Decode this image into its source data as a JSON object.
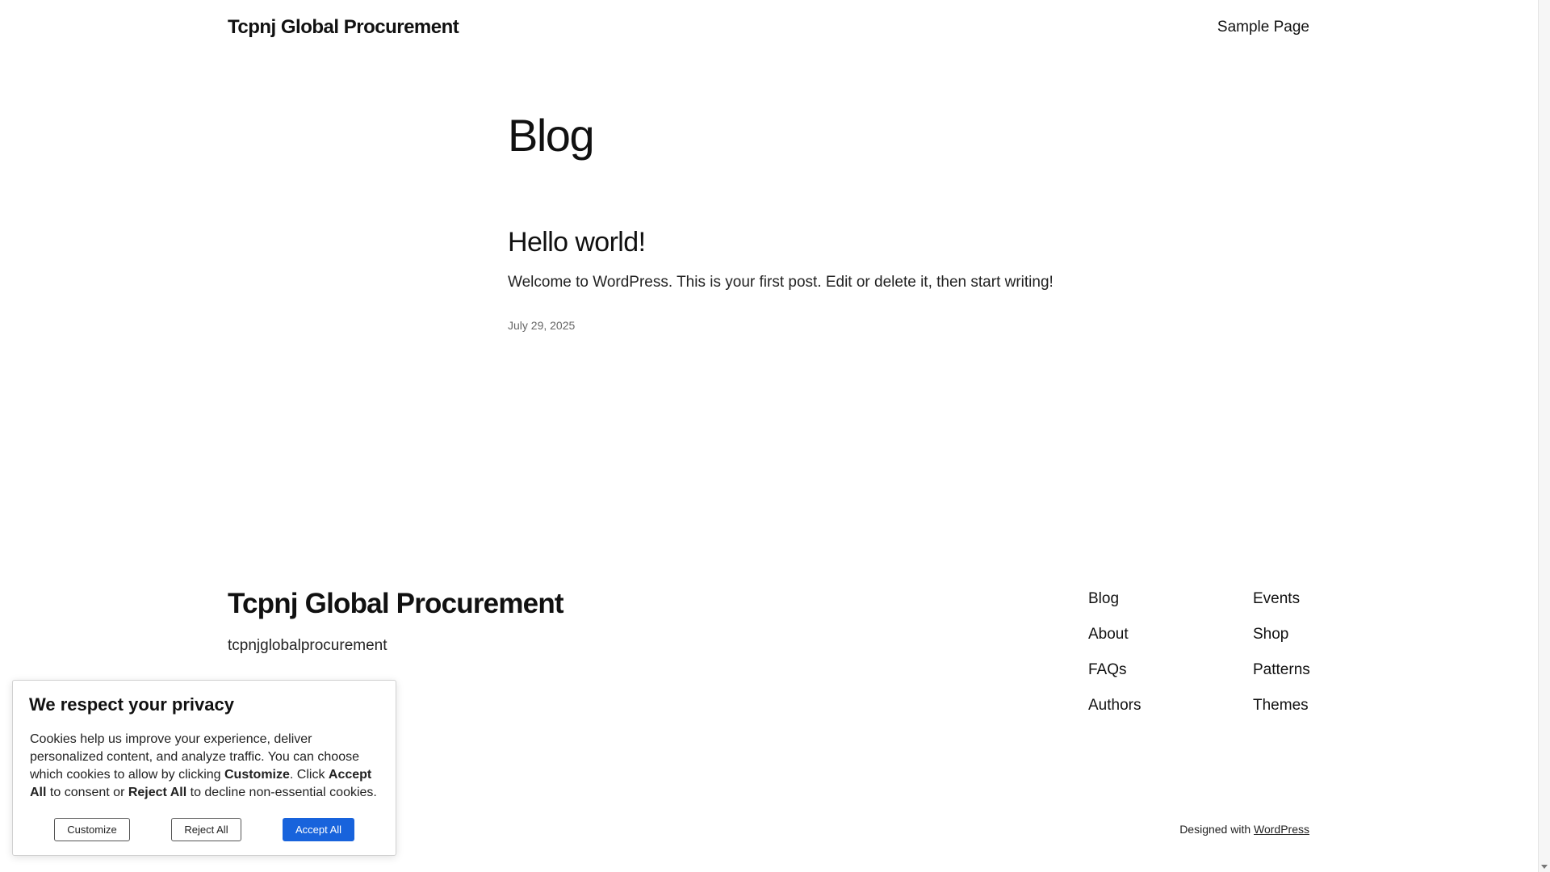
{
  "header": {
    "site_title": "Tcpnj Global Procurement",
    "nav": [
      "Sample Page"
    ]
  },
  "main": {
    "page_title": "Blog",
    "posts": [
      {
        "title": "Hello world!",
        "excerpt": "Welcome to WordPress. This is your first post. Edit or delete it, then start writing!",
        "date": "July 29, 2025"
      }
    ]
  },
  "footer": {
    "site_title": "Tcpnj Global Procurement",
    "tagline": "tcpnjglobalprocurement",
    "nav_col1": [
      "Blog",
      "About",
      "FAQs",
      "Authors"
    ],
    "nav_col2": [
      "Events",
      "Shop",
      "Patterns",
      "Themes"
    ],
    "credit_prefix": "Designed with ",
    "credit_link": "WordPress"
  },
  "cookie_banner": {
    "heading": "We respect your privacy",
    "text_1": "Cookies help us improve your experience, deliver personalized content, and analyze traffic. You can choose which cookies to allow by clicking ",
    "bold_customize": "Customize",
    "text_2": ". Click ",
    "bold_accept": "Accept All",
    "text_3": " to consent or ",
    "bold_reject": "Reject All",
    "text_4": " to decline non-essential cookies.",
    "buttons": {
      "customize": "Customize",
      "reject": "Reject All",
      "accept": "Accept All"
    },
    "accept_color": "#1863dc"
  }
}
